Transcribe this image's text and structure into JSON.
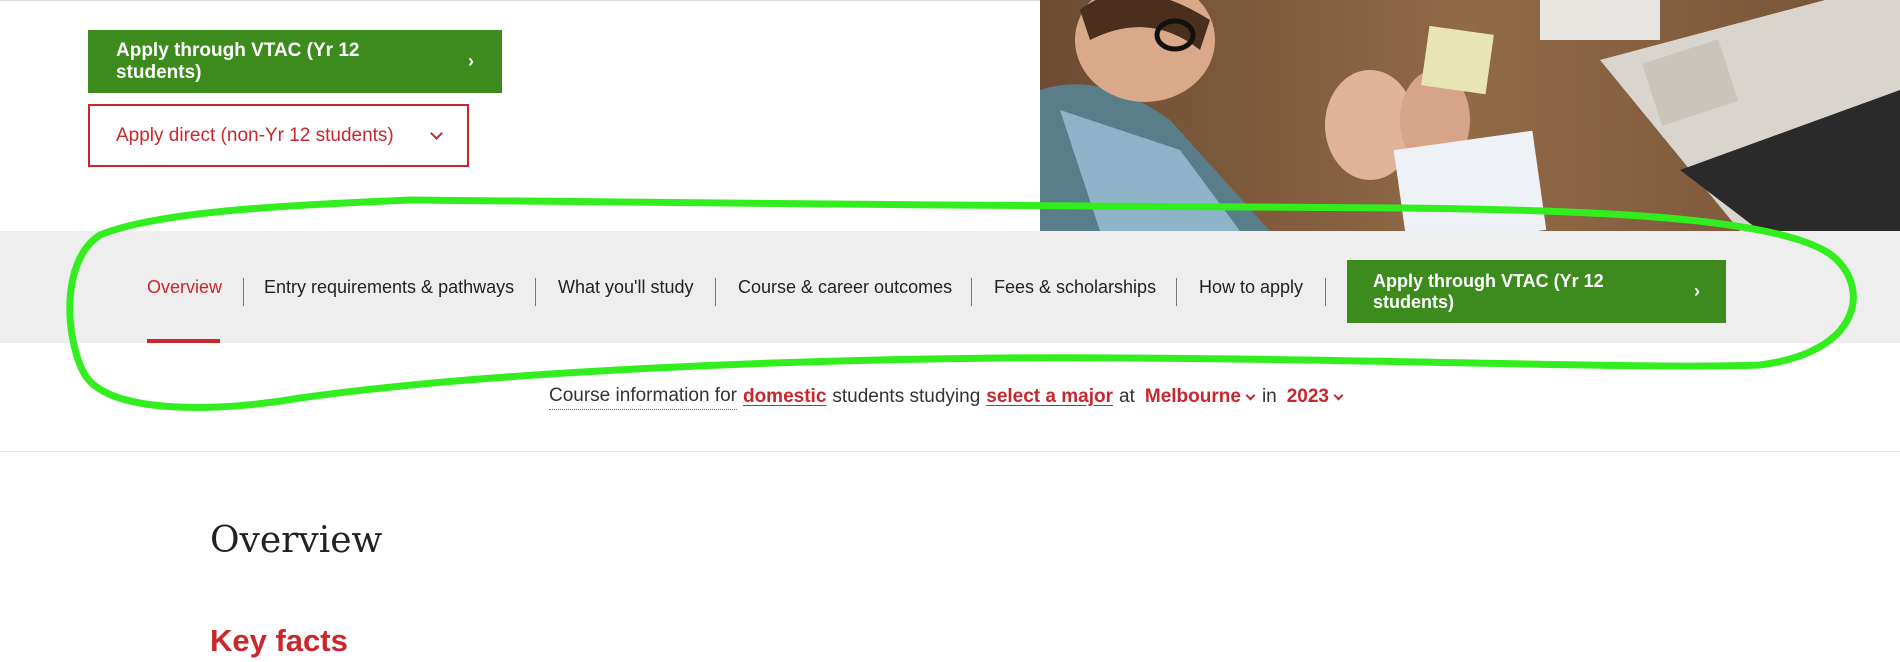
{
  "hero_buttons": {
    "vtac_label": "Apply through VTAC (Yr 12 students)",
    "direct_label": "Apply direct (non-Yr 12 students)"
  },
  "nav": {
    "items": [
      {
        "label": "Overview",
        "active": true
      },
      {
        "label": "Entry requirements & pathways",
        "active": false
      },
      {
        "label": "What you'll study",
        "active": false
      },
      {
        "label": "Course & career outcomes",
        "active": false
      },
      {
        "label": "Fees & scholarships",
        "active": false
      },
      {
        "label": "How to apply",
        "active": false
      }
    ],
    "cta_label": "Apply through VTAC (Yr 12 students)"
  },
  "course_info": {
    "prefix": "Course information for",
    "student_type": "domestic",
    "middle": "students studying",
    "major": "select a major",
    "at": "at",
    "campus": "Melbourne",
    "in": "in",
    "year": "2023"
  },
  "content": {
    "section_title": "Overview",
    "subsection_title": "Key facts"
  },
  "colors": {
    "primary_green": "#3d8b1d",
    "accent_red": "#c8282d",
    "annotation_green": "#33ee1f"
  }
}
